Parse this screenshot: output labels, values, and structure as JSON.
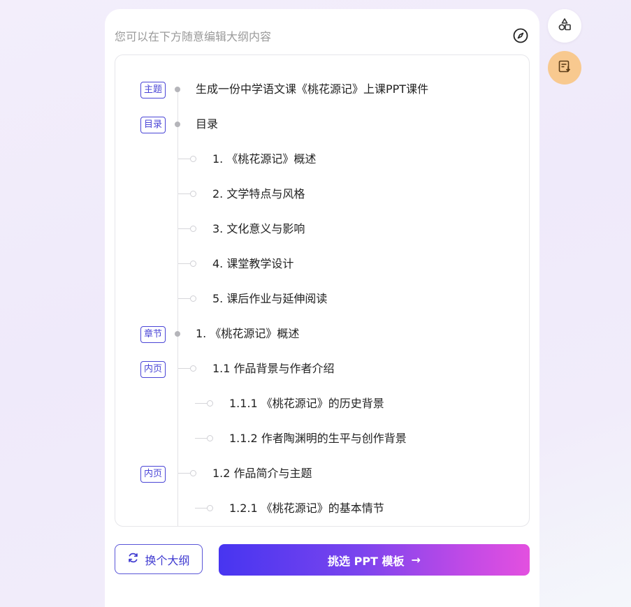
{
  "panel": {
    "hint": "您可以在下方随意编辑大纲内容",
    "compass_icon": "compass-icon"
  },
  "outline": [
    {
      "tag": "主题",
      "text": "生成一份中学语文课《桃花源记》上课PPT课件",
      "level": 0
    },
    {
      "tag": "目录",
      "text": "目录",
      "level": 0
    },
    {
      "tag": "",
      "text": "1. 《桃花源记》概述",
      "level": 1
    },
    {
      "tag": "",
      "text": "2. 文学特点与风格",
      "level": 1
    },
    {
      "tag": "",
      "text": "3. 文化意义与影响",
      "level": 1
    },
    {
      "tag": "",
      "text": "4. 课堂教学设计",
      "level": 1
    },
    {
      "tag": "",
      "text": "5. 课后作业与延伸阅读",
      "level": 1
    },
    {
      "tag": "章节",
      "text": "1. 《桃花源记》概述",
      "level": 0
    },
    {
      "tag": "内页",
      "text": "1.1 作品背景与作者介绍",
      "level": 1
    },
    {
      "tag": "",
      "text": "1.1.1 《桃花源记》的历史背景",
      "level": 2
    },
    {
      "tag": "",
      "text": "1.1.2 作者陶渊明的生平与创作背景",
      "level": 2
    },
    {
      "tag": "内页",
      "text": "1.2 作品简介与主题",
      "level": 1
    },
    {
      "tag": "",
      "text": "1.2.1 《桃花源记》的基本情节",
      "level": 2
    }
  ],
  "buttons": {
    "change_outline": "换个大纲",
    "choose_template": "挑选 PPT 模板",
    "arrow": "→"
  },
  "side": {
    "top_icon": "shapes-icon",
    "bottom_icon": "document-download-icon"
  },
  "colors": {
    "accent": "#4a45d6",
    "gradient_start": "#4735f0",
    "gradient_end": "#e350df",
    "side_orange": "#f8c98f"
  }
}
